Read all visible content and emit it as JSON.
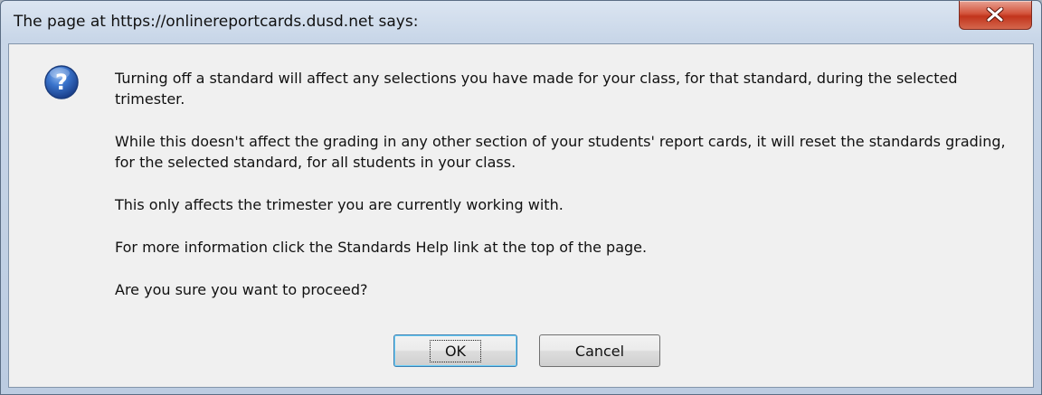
{
  "dialog": {
    "title": "The page at https://onlinereportcards.dusd.net says:",
    "close_icon": "close-x-icon",
    "message_icon": "question-icon",
    "message": [
      "Turning off a standard will affect any selections you have made for your class, for that standard, during the selected trimester.",
      "While this doesn't affect the grading in any other section of your students' report cards, it will reset the standards grading, for the selected standard, for all students in your class.",
      "This only affects the trimester you are currently working with.",
      "For more information click the Standards Help link at the top of the page.",
      "Are you sure you want to proceed?"
    ],
    "buttons": {
      "ok": "OK",
      "cancel": "Cancel"
    }
  },
  "colors": {
    "close_button": "#c7432b",
    "icon_blue": "#2d63b8",
    "focus_border": "#3c7fb1"
  }
}
